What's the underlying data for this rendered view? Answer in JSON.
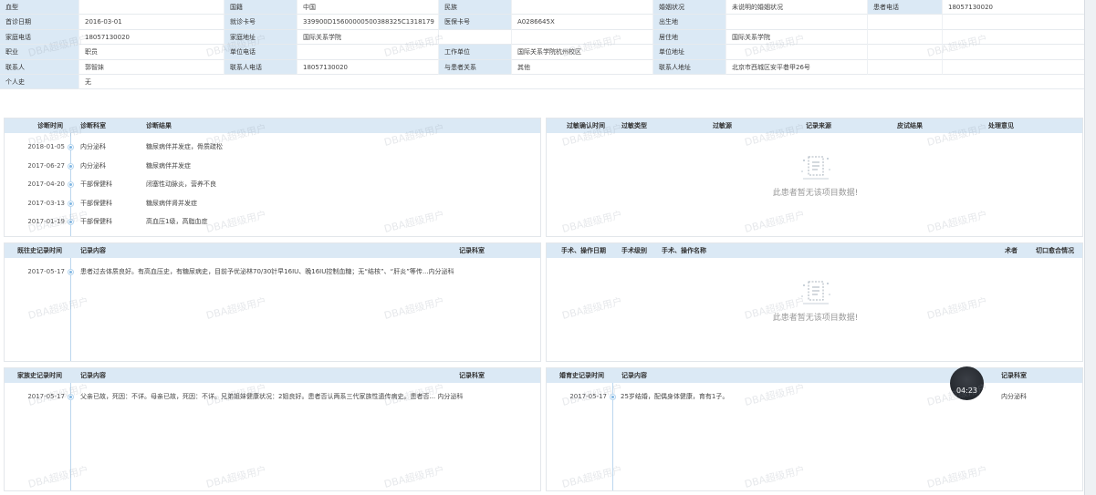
{
  "patient_info": [
    [
      {
        "l": "血型",
        "v": ""
      },
      {
        "l": "国籍",
        "v": "中国"
      },
      {
        "l": "民族",
        "v": ""
      },
      {
        "l": "婚姻状况",
        "v": "未说明的婚姻状况"
      },
      {
        "l": "患者电话",
        "v": "18057130020"
      }
    ],
    [
      {
        "l": "首诊日期",
        "v": "2016-03-01"
      },
      {
        "l": "就诊卡号",
        "v": "339900D156000005003883​25C1318179"
      },
      {
        "l": "医保卡号",
        "v": "A0286645X"
      },
      {
        "l": "出生地",
        "v": ""
      },
      {
        "l": "",
        "v": ""
      }
    ],
    [
      {
        "l": "家庭电话",
        "v": "18057130020"
      },
      {
        "l": "家庭地址",
        "v": "国际关系学院"
      },
      {
        "l": "",
        "v": ""
      },
      {
        "l": "居住地",
        "v": "国际关系学院"
      },
      {
        "l": "",
        "v": ""
      }
    ],
    [
      {
        "l": "职业",
        "v": "职员"
      },
      {
        "l": "单位电话",
        "v": ""
      },
      {
        "l": "工作单位",
        "v": "国际关系学院杭州校区"
      },
      {
        "l": "单位地址",
        "v": ""
      },
      {
        "l": "",
        "v": ""
      }
    ],
    [
      {
        "l": "联系人",
        "v": "郭智妹"
      },
      {
        "l": "联系人电话",
        "v": "18057130020"
      },
      {
        "l": "与患者关系",
        "v": "其他"
      },
      {
        "l": "联系人地址",
        "v": "北京市西城区安平巷甲26号"
      },
      {
        "l": "",
        "v": ""
      }
    ]
  ],
  "personal_history": {
    "label": "个人史",
    "value": "无"
  },
  "diagnosis": {
    "headers": [
      "诊断时间",
      "诊断科室",
      "诊断结果"
    ],
    "rows": [
      {
        "date": "2018-01-05",
        "dept": "内分泌科",
        "result": "糖尿病伴并发症，骨质疏松"
      },
      {
        "date": "2017-06-27",
        "dept": "内分泌科",
        "result": "糖尿病伴并发症"
      },
      {
        "date": "2017-04-20",
        "dept": "干部保健科",
        "result": "闭塞性动脉炎，营养不良"
      },
      {
        "date": "2017-03-13",
        "dept": "干部保健科",
        "result": "糖尿病伴肾并发症"
      },
      {
        "date": "2017-01-19",
        "dept": "干部保健科",
        "result": "高血压1级，高脂血症"
      }
    ]
  },
  "allergy": {
    "headers": [
      "过敏确认时间",
      "过敏类型",
      "过敏源",
      "记录来源",
      "皮试结果",
      "处理意见"
    ],
    "empty": "此患者暂无该项目数据!"
  },
  "past_history": {
    "headers": [
      "既往史记录时间",
      "记录内容",
      "记录科室"
    ],
    "rows": [
      {
        "date": "2017-05-17",
        "content": "患者过去体质良好。有高血压史，有糖尿病史，目前予优泌林70/30针早16IU、晚16IU控制血糖；无“结核”、“肝炎”等传...内分泌科"
      }
    ]
  },
  "surgery": {
    "headers": [
      "手术、操作日期",
      "手术级别",
      "手术、操作名称",
      "术者",
      "切口愈合情况"
    ],
    "empty": "此患者暂无该项目数据!"
  },
  "family_history": {
    "headers": [
      "家族史记录时间",
      "记录内容",
      "记录科室"
    ],
    "rows": [
      {
        "date": "2017-05-17",
        "content": "父亲已故，死因：不详。母亲已故，死因：不详。兄弟姐妹健康状况：2姐良好。患者否认两系三代家族性遗传病史。患者否... 内分泌科"
      }
    ]
  },
  "marriage_history": {
    "headers": [
      "婚育史记录时间",
      "记录内容",
      "记录科室"
    ],
    "rows": [
      {
        "date": "2017-05-17",
        "content": "25岁结婚，配偶身体健康，育有1子。",
        "dept": "内分泌科"
      }
    ]
  },
  "timer": "04:23",
  "watermark": "DBA超级用户"
}
